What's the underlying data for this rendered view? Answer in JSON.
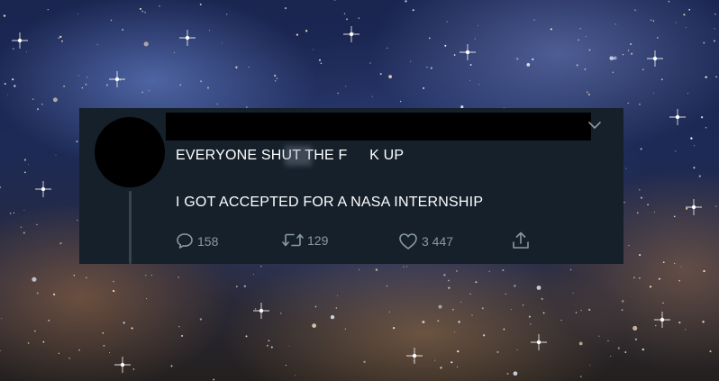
{
  "tweet": {
    "line_1": "EVERYONE SHUT THE F   K UP",
    "line_2": "I GOT ACCEPTED FOR A NASA INTERNSHIP"
  },
  "actions": {
    "replies": "158",
    "retweets": "129",
    "likes": "3 447"
  },
  "icons": {
    "reply": "speech-bubble-icon",
    "retweet": "retweet-arrows-icon",
    "like": "heart-icon",
    "share": "share-upload-icon",
    "menu": "chevron-down-icon"
  },
  "colors": {
    "card_background": "#15202b",
    "text": "#ffffff",
    "action_gray": "#8899a6"
  }
}
